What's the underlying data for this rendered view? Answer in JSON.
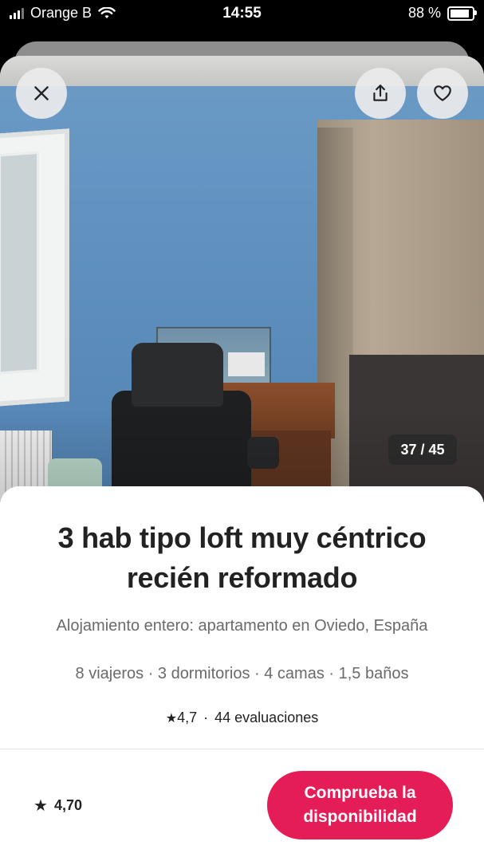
{
  "status_bar": {
    "carrier": "Orange B",
    "time": "14:55",
    "battery": "88 %",
    "battery_level": 0.88
  },
  "photo": {
    "counter": "37 / 45",
    "current": 37,
    "total": 45
  },
  "listing": {
    "title": "3 hab  tipo loft muy céntrico recién reformado",
    "subtitle": "Alojamiento entero: apartamento en Oviedo, España",
    "specs": "8 viajeros · 3 dormitorios · 4 camas · 1,5 baños",
    "rating": "4,7",
    "separator": "·",
    "reviews": "44 evaluaciones"
  },
  "footer": {
    "rating": "4,70",
    "cta_label": "Comprueba la disponibilidad"
  },
  "colors": {
    "accent": "#e51d57",
    "text": "#222222",
    "muted": "#6a6a6a"
  },
  "icons": {
    "close": "close-icon",
    "share": "share-icon",
    "save": "heart-icon",
    "star": "star-icon"
  }
}
